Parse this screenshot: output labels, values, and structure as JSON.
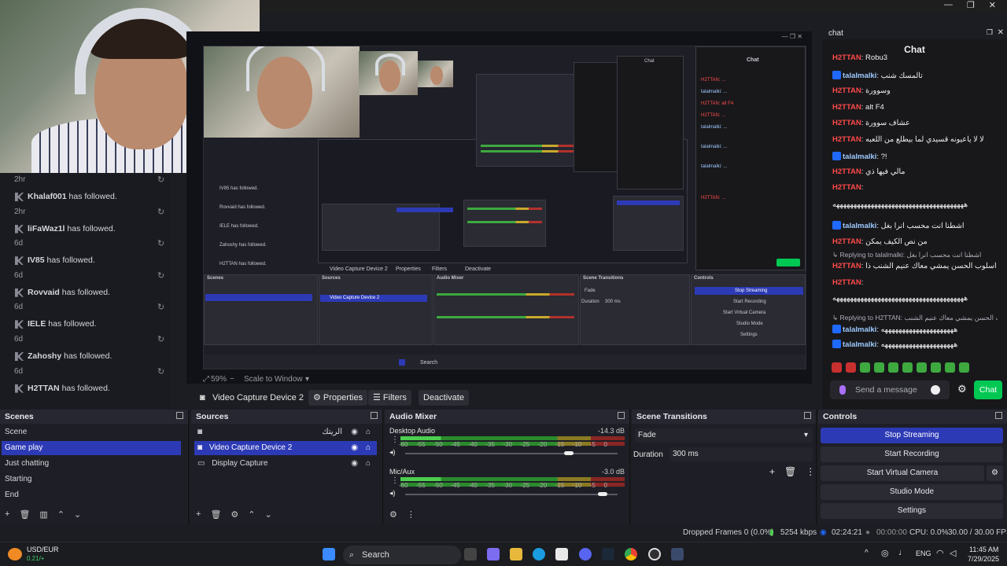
{
  "window": {
    "minimize": "—",
    "restore": "❐",
    "close": "✕"
  },
  "followers": [
    {
      "ts": "2hr",
      "name": "Khalaf001",
      "action": "has followed."
    },
    {
      "ts": "2hr",
      "name": "liFaWaz1l",
      "action": "has followed."
    },
    {
      "ts": "6d",
      "name": "IV85",
      "action": "has followed."
    },
    {
      "ts": "6d",
      "name": "Rovvaid",
      "action": "has followed."
    },
    {
      "ts": "6d",
      "name": "IELE",
      "action": "has followed."
    },
    {
      "ts": "6d",
      "name": "Zahoshy",
      "action": "has followed."
    },
    {
      "ts": "6d",
      "name": "H2TTAN",
      "action": "has followed."
    }
  ],
  "preview": {
    "zoom": "59%",
    "scale": "Scale to Window",
    "inner_labels": {
      "source": "Video Capture Device 2",
      "properties": "Properties",
      "filters": "Filters",
      "deactivate": "Deactivate",
      "scenes": "Scenes",
      "sources": "Sources",
      "audio": "Audio Mixer",
      "transitions": "Scene Transitions",
      "controls": "Controls",
      "stop": "Stop Streaming",
      "record": "Start Recording",
      "vcam": "Start Virtual Camera",
      "studio": "Studio Mode",
      "settings": "Settings",
      "chat": "Chat",
      "search": "Search",
      "fade": "Fade",
      "duration": "Duration",
      "duration_val": "300 ms"
    }
  },
  "source_bar": {
    "name": "Video Capture Device 2",
    "properties": "Properties",
    "filters": "Filters",
    "deactivate": "Deactivate"
  },
  "chat": {
    "dock_title": "chat",
    "title": "Chat",
    "messages": [
      {
        "user": "H2TTAN",
        "color": "#ff4a4a",
        "text": ": Robu3",
        "badge": false
      },
      {
        "user": "talalmalki",
        "color": "#9ecbff",
        "text": ": تالمسك شنب",
        "badge": true
      },
      {
        "user": "H2TTAN",
        "color": "#ff4a4a",
        "text": ": وسوورة",
        "badge": false
      },
      {
        "user": "H2TTAN",
        "color": "#ff4a4a",
        "text": ": alt F4",
        "badge": false
      },
      {
        "user": "H2TTAN",
        "color": "#ff4a4a",
        "text": ": عشاف سوورة",
        "badge": false
      },
      {
        "user": "H2TTAN",
        "color": "#ff4a4a",
        "text": ": لا لا ياعيونه قسيدي لما بيطلع من اللعبه",
        "badge": false
      },
      {
        "user": "talalmalki",
        "color": "#9ecbff",
        "text": ": ?!",
        "badge": true
      },
      {
        "user": "H2TTAN",
        "color": "#ff4a4a",
        "text": ": مالي فيها ذي",
        "badge": false
      },
      {
        "user": "H2TTAN",
        "color": "#ff4a4a",
        "text": ":",
        "badge": false
      },
      {
        "user": "",
        "color": "#efeff1",
        "text": "ههههههههههههههههههههههههههههههههههههههه",
        "badge": false
      },
      {
        "user": "talalmalki",
        "color": "#9ecbff",
        "text": ": اشطنا انت محسب انرا بغل",
        "badge": true
      },
      {
        "user": "H2TTAN",
        "color": "#ff4a4a",
        "text": ": من نص الكيف يمكن",
        "badge": false
      },
      {
        "user": "",
        "color": "#adadb8",
        "text": "↳ Replying to talalmalki: اشطنا انت محسب انرا بغل",
        "badge": false
      },
      {
        "user": "H2TTAN",
        "color": "#ff4a4a",
        "text": ": استخدم معاه اسلوب الحسن يمشي معاك عنيم الشنب ذا",
        "badge": false
      },
      {
        "user": "H2TTAN",
        "color": "#ff4a4a",
        "text": ":",
        "badge": false
      },
      {
        "user": "",
        "color": "#efeff1",
        "text": "ههههههههههههههههههههههههههههههههههههههه",
        "badge": false
      },
      {
        "user": "",
        "color": "#adadb8",
        "text": "↳ Replying to H2TTAN: اسلوب الحسن يمشي معاك عنيم الشنب",
        "badge": false
      },
      {
        "user": "talalmalki",
        "color": "#9ecbff",
        "text": ": هههههههههههههههههههههه",
        "badge": true
      },
      {
        "user": "talalmalki",
        "color": "#9ecbff",
        "text": ": هههههههههههههههههههههه",
        "badge": true
      }
    ],
    "input_placeholder": "Send a message",
    "send_label": "Chat"
  },
  "scenes": {
    "title": "Scenes",
    "items": [
      "Scene",
      "Game play",
      "Just chatting",
      "Starting",
      "End"
    ],
    "selected": 1
  },
  "sources": {
    "title": "Sources",
    "items": [
      "الريتك",
      "Video Capture Device 2",
      "Display Capture"
    ],
    "selected": 1
  },
  "audio": {
    "title": "Audio Mixer",
    "channels": [
      {
        "name": "Desktop Audio",
        "db": "-14.3 dB",
        "volume": 0.77
      },
      {
        "name": "Mic/Aux",
        "db": "-3.0 dB",
        "volume": 0.93
      }
    ],
    "ticks": [
      "-60",
      "-55",
      "-50",
      "-45",
      "-40",
      "-35",
      "-30",
      "-25",
      "-20",
      "-15",
      "-10",
      "-5",
      "0"
    ]
  },
  "transitions": {
    "title": "Scene Transitions",
    "type": "Fade",
    "duration_label": "Duration",
    "duration": "300 ms"
  },
  "controls": {
    "title": "Controls",
    "stop": "Stop Streaming",
    "record": "Start Recording",
    "vcam": "Start Virtual Camera",
    "studio": "Studio Mode",
    "settings": "Settings"
  },
  "status": {
    "dropped": "Dropped Frames 0 (0.0%)",
    "kbps": "5254 kbps",
    "live": "02:24:21",
    "rec": "00:00:00",
    "cpu": "CPU: 0.0%",
    "fps": "30.00 / 30.00 FPS"
  },
  "taskbar": {
    "ticker_name": "USD/EUR",
    "ticker_change": "0.21/+",
    "search": "Search",
    "lang": "ENG",
    "time": "11:45 AM",
    "date": "7/29/2025"
  },
  "colors": {
    "accent": "#2d3ab5",
    "twitch_green": "#00c853",
    "meter_green": "#4ccf4f"
  }
}
